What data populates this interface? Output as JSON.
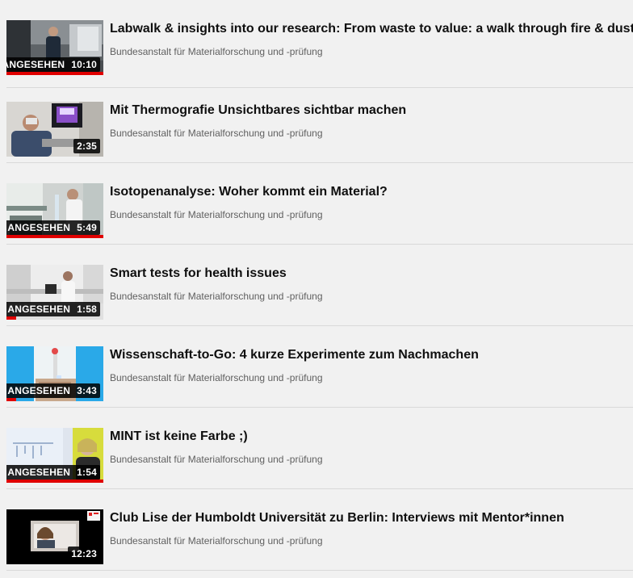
{
  "videos": [
    {
      "title": "Labwalk & insights into our research: From waste to value: a walk through fire & dust",
      "channel": "Bundesanstalt für Materialforschung und -prüfung",
      "watched_label": "ANGESEHEN",
      "duration": "10:10",
      "watched": true,
      "progress": 1.0
    },
    {
      "title": "Mit Thermografie Unsichtbares sichtbar machen",
      "channel": "Bundesanstalt für Materialforschung und -prüfung",
      "watched_label": "",
      "duration": "2:35",
      "watched": false,
      "progress": 0
    },
    {
      "title": "Isotopenanalyse: Woher kommt ein Material?",
      "channel": "Bundesanstalt für Materialforschung und -prüfung",
      "watched_label": "ANGESEHEN",
      "duration": "5:49",
      "watched": true,
      "progress": 1.0
    },
    {
      "title": "Smart tests for health issues",
      "channel": "Bundesanstalt für Materialforschung und -prüfung",
      "watched_label": "ANGESEHEN",
      "duration": "1:58",
      "watched": true,
      "progress": 0.1
    },
    {
      "title": "Wissenschaft-to-Go: 4 kurze Experimente zum Nachmachen",
      "channel": "Bundesanstalt für Materialforschung und -prüfung",
      "watched_label": "ANGESEHEN",
      "duration": "3:43",
      "watched": true,
      "progress": 0.1
    },
    {
      "title": "MINT ist keine Farbe ;)",
      "channel": "Bundesanstalt für Materialforschung und -prüfung",
      "watched_label": "ANGESEHEN",
      "duration": "1:54",
      "watched": true,
      "progress": 1.0
    },
    {
      "title": "Club Lise der Humboldt Universität zu Berlin: Interviews mit Mentor*innen",
      "channel": "Bundesanstalt für Materialforschung und -prüfung",
      "watched_label": "",
      "duration": "12:23",
      "watched": false,
      "progress": 0
    }
  ],
  "colors": {
    "background": "#f1f1f1",
    "progress": "#e00000",
    "title": "#0f0f0f",
    "channel": "#606060"
  }
}
